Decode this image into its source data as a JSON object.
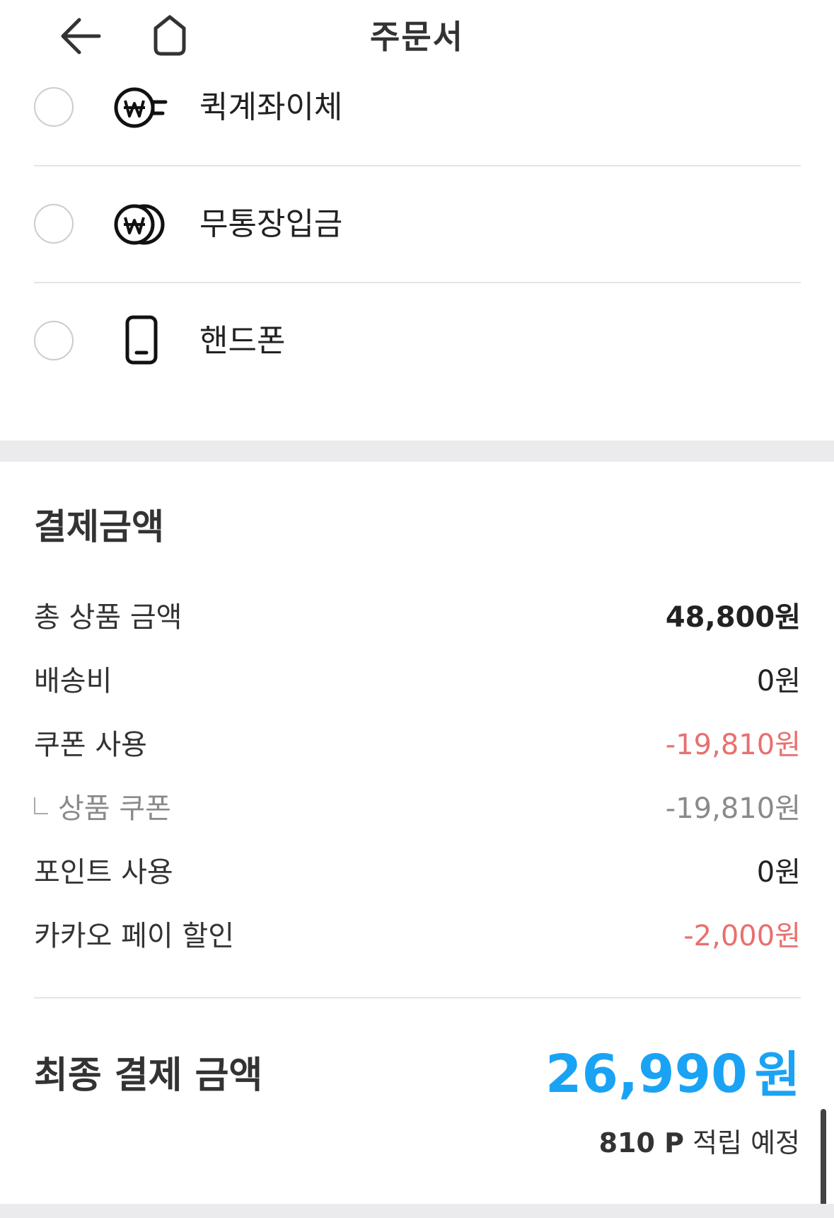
{
  "header": {
    "title": "주문서",
    "back_icon": "arrow-left-icon",
    "home_icon": "home-icon"
  },
  "payment_methods": [
    {
      "label": "퀵계좌이체",
      "icon": "won-transfer-icon",
      "selected": false
    },
    {
      "label": "무통장입금",
      "icon": "won-coins-icon",
      "selected": false
    },
    {
      "label": "핸드폰",
      "icon": "mobile-phone-icon",
      "selected": false
    }
  ],
  "summary": {
    "title": "결제금액",
    "rows": [
      {
        "label": "총 상품 금액",
        "value": "48,800원"
      },
      {
        "label": "배송비",
        "value": "0원"
      },
      {
        "label": "쿠폰 사용",
        "value": "-19,810원"
      },
      {
        "label": "상품 쿠폰",
        "value": "-19,810원"
      },
      {
        "label": "포인트 사용",
        "value": "0원"
      },
      {
        "label": "카카오 페이 할인",
        "value": "-2,000원"
      }
    ],
    "final_label": "최종 결제 금액",
    "final_amount": "26,990",
    "final_unit": "원",
    "points": "810 P",
    "points_suffix": "적립 예정"
  },
  "colors": {
    "accent": "#1aa3f5",
    "discount": "#e8706f",
    "muted": "#8a8a8a"
  }
}
